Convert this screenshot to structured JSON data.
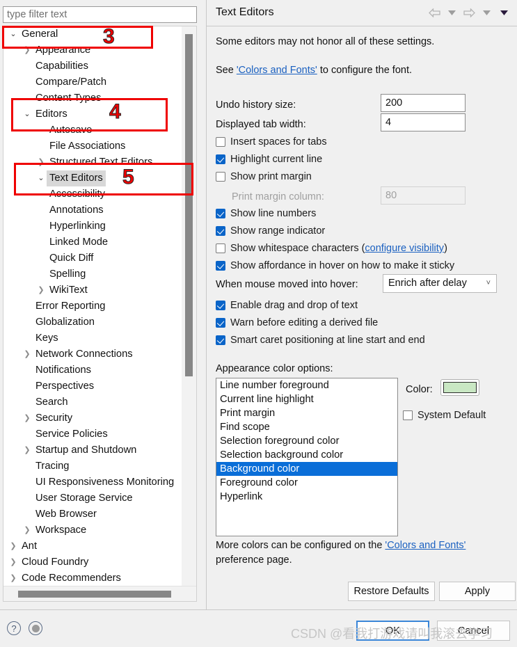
{
  "filter": {
    "placeholder": "type filter text",
    "value": ""
  },
  "tree": {
    "items": [
      {
        "label": "General",
        "level": 0,
        "arrow": "open",
        "selected": false
      },
      {
        "label": "Appearance",
        "level": 1,
        "arrow": "closed",
        "selected": false
      },
      {
        "label": "Capabilities",
        "level": 1,
        "arrow": "none",
        "selected": false
      },
      {
        "label": "Compare/Patch",
        "level": 1,
        "arrow": "none",
        "selected": false
      },
      {
        "label": "Content Types",
        "level": 1,
        "arrow": "none",
        "selected": false
      },
      {
        "label": "Editors",
        "level": 1,
        "arrow": "open",
        "selected": false
      },
      {
        "label": "Autosave",
        "level": 2,
        "arrow": "none",
        "selected": false
      },
      {
        "label": "File Associations",
        "level": 2,
        "arrow": "none",
        "selected": false
      },
      {
        "label": "Structured Text Editors",
        "level": 2,
        "arrow": "closed",
        "selected": false
      },
      {
        "label": "Text Editors",
        "level": 2,
        "arrow": "open",
        "selected": true
      },
      {
        "label": "Accessibility",
        "level": 2,
        "arrow": "none",
        "selected": false
      },
      {
        "label": "Annotations",
        "level": 2,
        "arrow": "none",
        "selected": false
      },
      {
        "label": "Hyperlinking",
        "level": 2,
        "arrow": "none",
        "selected": false
      },
      {
        "label": "Linked Mode",
        "level": 2,
        "arrow": "none",
        "selected": false
      },
      {
        "label": "Quick Diff",
        "level": 2,
        "arrow": "none",
        "selected": false
      },
      {
        "label": "Spelling",
        "level": 2,
        "arrow": "none",
        "selected": false
      },
      {
        "label": "WikiText",
        "level": 2,
        "arrow": "closed",
        "selected": false
      },
      {
        "label": "Error Reporting",
        "level": 1,
        "arrow": "none",
        "selected": false
      },
      {
        "label": "Globalization",
        "level": 1,
        "arrow": "none",
        "selected": false
      },
      {
        "label": "Keys",
        "level": 1,
        "arrow": "none",
        "selected": false
      },
      {
        "label": "Network Connections",
        "level": 1,
        "arrow": "closed",
        "selected": false
      },
      {
        "label": "Notifications",
        "level": 1,
        "arrow": "none",
        "selected": false
      },
      {
        "label": "Perspectives",
        "level": 1,
        "arrow": "none",
        "selected": false
      },
      {
        "label": "Search",
        "level": 1,
        "arrow": "none",
        "selected": false
      },
      {
        "label": "Security",
        "level": 1,
        "arrow": "closed",
        "selected": false
      },
      {
        "label": "Service Policies",
        "level": 1,
        "arrow": "none",
        "selected": false
      },
      {
        "label": "Startup and Shutdown",
        "level": 1,
        "arrow": "closed",
        "selected": false
      },
      {
        "label": "Tracing",
        "level": 1,
        "arrow": "none",
        "selected": false
      },
      {
        "label": "UI Responsiveness Monitoring",
        "level": 1,
        "arrow": "none",
        "selected": false
      },
      {
        "label": "User Storage Service",
        "level": 1,
        "arrow": "none",
        "selected": false
      },
      {
        "label": "Web Browser",
        "level": 1,
        "arrow": "none",
        "selected": false
      },
      {
        "label": "Workspace",
        "level": 1,
        "arrow": "closed",
        "selected": false
      },
      {
        "label": "Ant",
        "level": 0,
        "arrow": "closed",
        "selected": false
      },
      {
        "label": "Cloud Foundry",
        "level": 0,
        "arrow": "closed",
        "selected": false
      },
      {
        "label": "Code Recommenders",
        "level": 0,
        "arrow": "closed",
        "selected": false
      }
    ]
  },
  "page": {
    "title": "Text Editors",
    "intro_line1": "Some editors may not honor all of these settings.",
    "see_prefix": "See ",
    "colors_fonts_link": "'Colors and Fonts'",
    "see_suffix": " to configure the font.",
    "undo_label": "Undo history size:",
    "undo_value": "200",
    "tabwidth_label": "Displayed tab width:",
    "tabwidth_value": "4",
    "cb_insert_spaces": "Insert spaces for tabs",
    "cb_highlight_line": "Highlight current line",
    "cb_print_margin": "Show print margin",
    "print_margin_col_label": "Print margin column:",
    "print_margin_col_value": "80",
    "cb_line_numbers": "Show line numbers",
    "cb_range_indicator": "Show range indicator",
    "cb_whitespace_prefix": "Show whitespace characters (",
    "cb_whitespace_link": "configure visibility",
    "cb_whitespace_suffix": ")",
    "cb_affordance": "Show affordance in hover on how to make it sticky",
    "hover_label": "When mouse moved into hover:",
    "hover_value": "Enrich after delay",
    "cb_dragdrop": "Enable drag and drop of text",
    "cb_warn_derived": "Warn before editing a derived file",
    "cb_smart_caret": "Smart caret positioning at line start and end",
    "appearance_label": "Appearance color options:",
    "color_label": "Color:",
    "color_value": "#c9e7c3",
    "cb_system_default": "System Default",
    "more_colors_prefix": "More colors can be configured on the ",
    "more_colors_link": "'Colors and Fonts'",
    "more_colors_suffix": "preference page.",
    "btn_restore_defaults": "Restore Defaults",
    "btn_apply": "Apply"
  },
  "checkbox_states": {
    "insert_spaces": false,
    "highlight_line": true,
    "print_margin": false,
    "line_numbers": true,
    "range_indicator": true,
    "whitespace": false,
    "affordance": true,
    "dragdrop": true,
    "warn_derived": true,
    "smart_caret": true,
    "system_default": false
  },
  "color_list": {
    "items": [
      "Line number foreground",
      "Current line highlight",
      "Print margin",
      "Find scope",
      "Selection foreground color",
      "Selection background color",
      "Background color",
      "Foreground color",
      "Hyperlink"
    ],
    "selected_index": 6
  },
  "dialog_buttons": {
    "ok": "OK",
    "cancel": "Cancel"
  },
  "annotations": [
    {
      "number": "3",
      "target": "General"
    },
    {
      "number": "4",
      "target": "Editors"
    },
    {
      "number": "5",
      "target": "Text Editors"
    }
  ],
  "watermark": {
    "text": "CSDN @看我打游戏请叫我滚去学习"
  },
  "colors": {
    "accent": "#0a64c8",
    "selection": "#0a6ed8",
    "annotation": "#ef0000",
    "link": "#1a60c0"
  }
}
